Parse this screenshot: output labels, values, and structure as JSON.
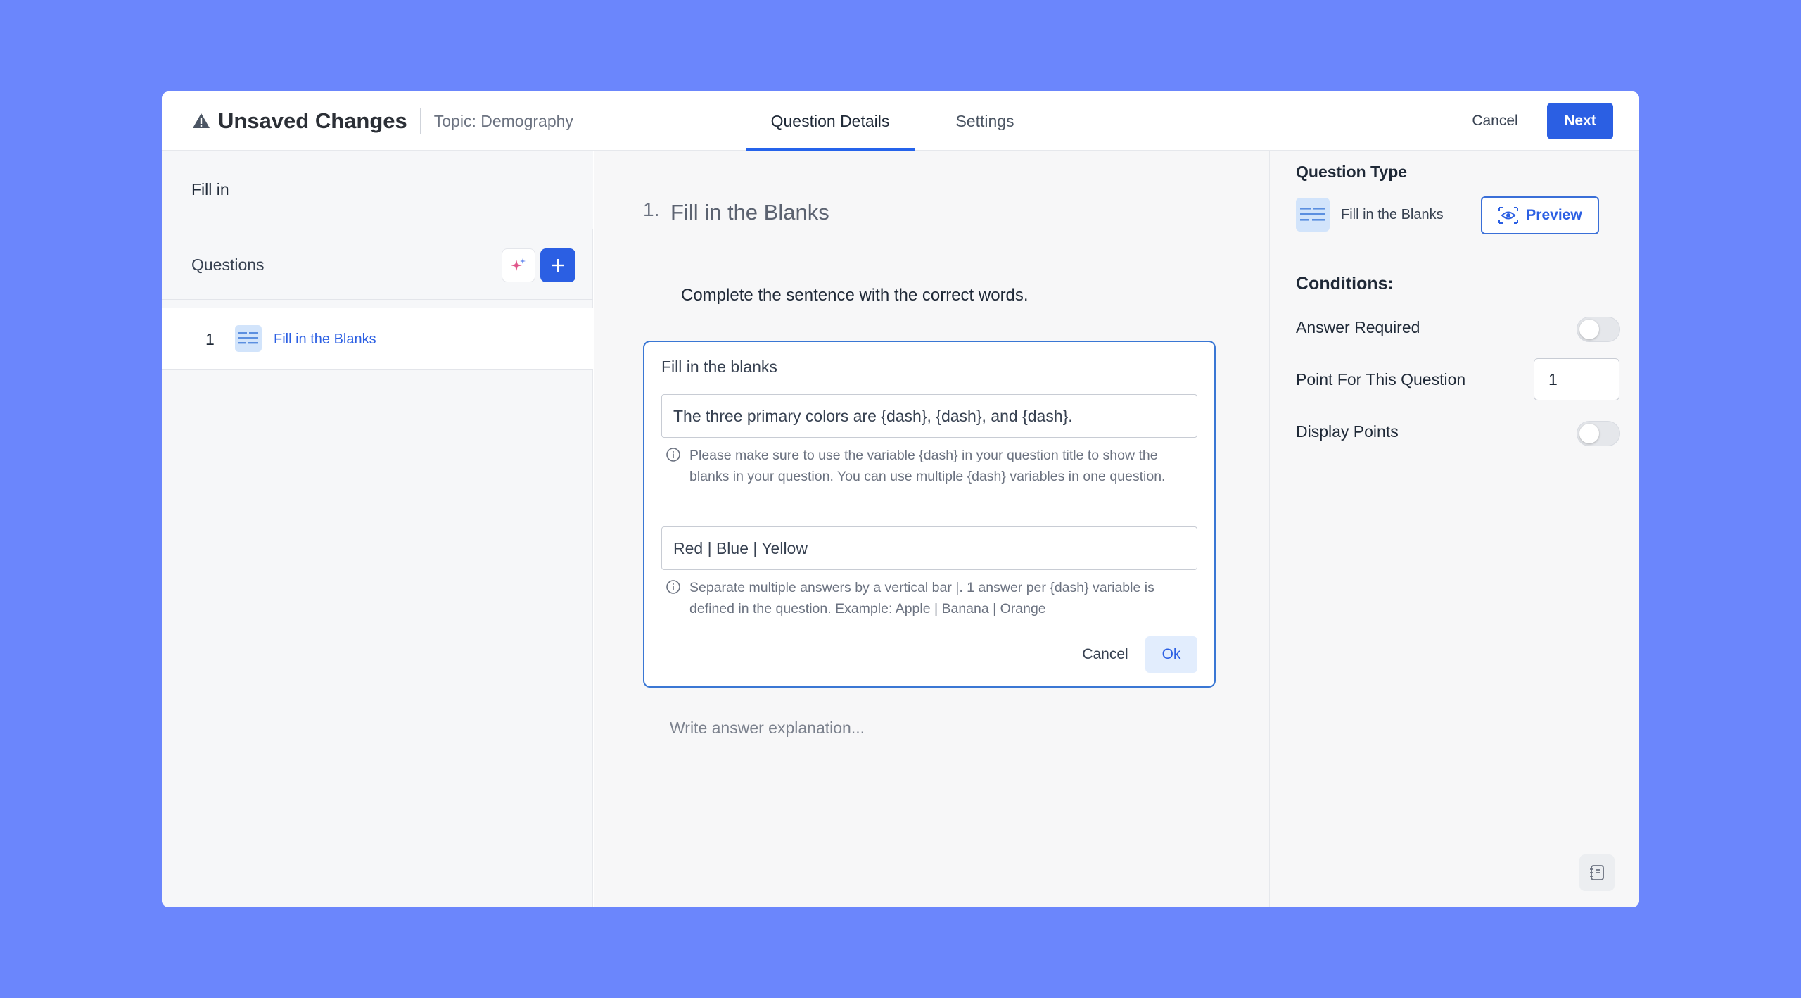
{
  "header": {
    "title": "Unsaved Changes",
    "topic": "Topic: Demography",
    "tabs": [
      {
        "label": "Question Details",
        "active": true
      },
      {
        "label": "Settings",
        "active": false
      }
    ],
    "cancel_label": "Cancel",
    "next_label": "Next"
  },
  "sidebar": {
    "quiz_title": "Fill in",
    "questions_label": "Questions",
    "items": [
      {
        "number": "1",
        "label": "Fill in the Blanks",
        "icon": "fill-in-blanks-icon"
      }
    ]
  },
  "editor": {
    "question_number": "1.",
    "question_title": "Fill in the Blanks",
    "prompt": "Complete the sentence with the correct words.",
    "card": {
      "title": "Fill in the blanks",
      "sentence_value": "The three primary colors are {dash}, {dash}, and {dash}.",
      "sentence_hint": "Please make sure to use the variable {dash} in your question title to show the blanks in your question. You can use multiple {dash} variables in one question.",
      "answers_value": "Red | Blue | Yellow",
      "answers_hint": "Separate multiple answers by a vertical bar |. 1 answer per {dash} variable is defined in the question. Example: Apple | Banana | Orange",
      "cancel_label": "Cancel",
      "ok_label": "Ok"
    },
    "explanation_placeholder": "Write answer explanation..."
  },
  "panel": {
    "question_type_label": "Question Type",
    "question_type_value": "Fill in the Blanks",
    "preview_label": "Preview",
    "conditions_label": "Conditions:",
    "answer_required_label": "Answer Required",
    "answer_required": false,
    "points_label": "Point For This Question",
    "points_value": "1",
    "display_points_label": "Display Points",
    "display_points": false
  },
  "colors": {
    "background": "#6b86fc",
    "accent": "#2b5fe3",
    "card_border": "#3a77d4"
  }
}
